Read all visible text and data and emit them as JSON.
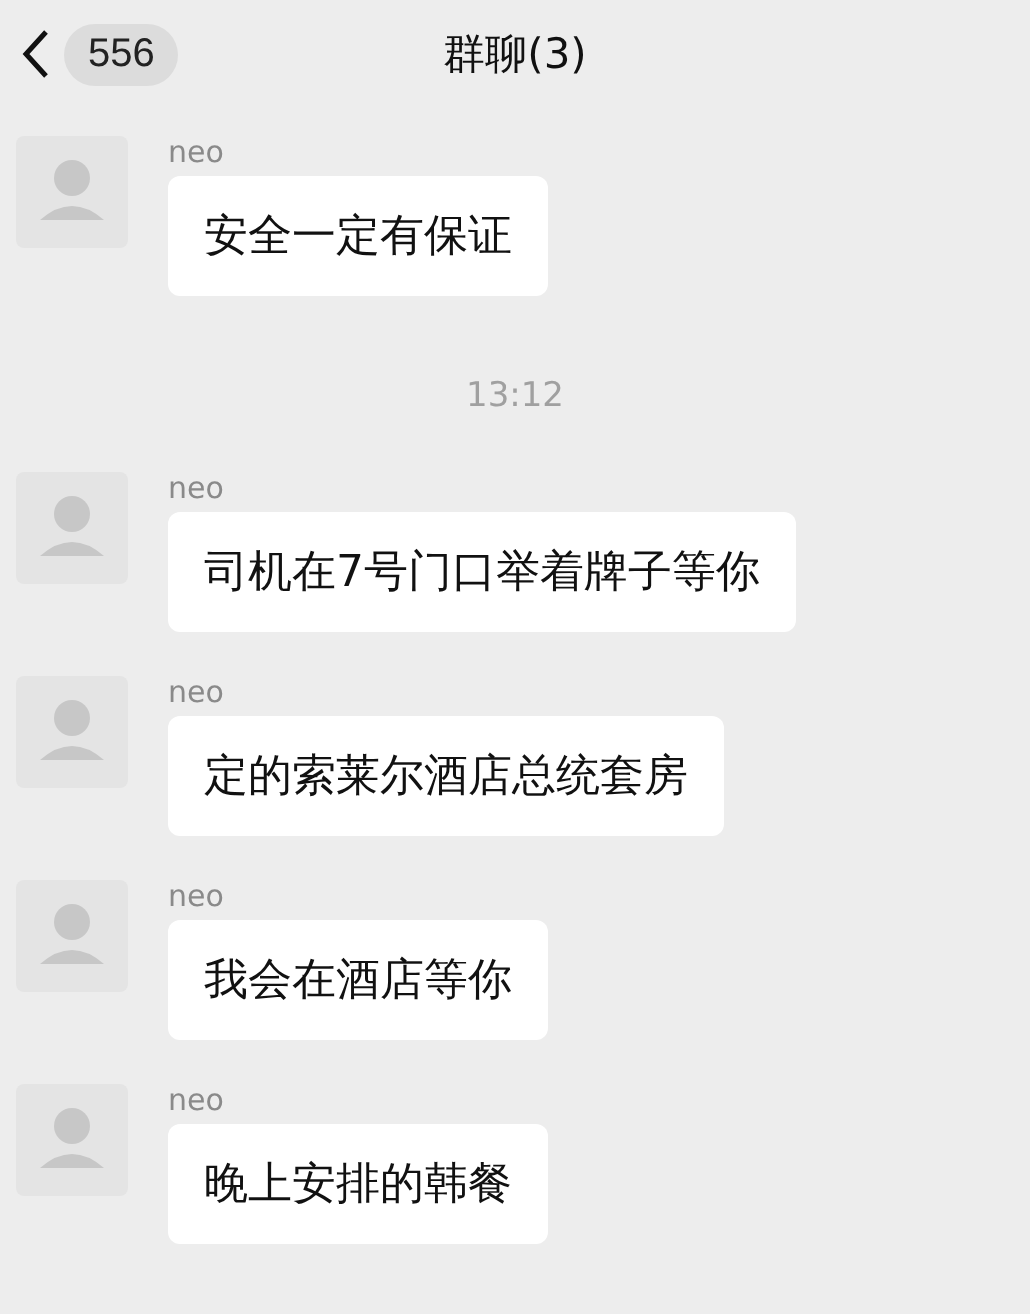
{
  "header": {
    "back_count": "556",
    "title": "群聊(3)"
  },
  "messages": [
    {
      "kind": "message",
      "sender": "neo",
      "text": "安全一定有保证"
    },
    {
      "kind": "time",
      "text": "13:12"
    },
    {
      "kind": "message",
      "sender": "neo",
      "text": "司机在7号门口举着牌子等你"
    },
    {
      "kind": "message",
      "sender": "neo",
      "text": "定的索莱尔酒店总统套房"
    },
    {
      "kind": "message",
      "sender": "neo",
      "text": "我会在酒店等你"
    },
    {
      "kind": "message",
      "sender": "neo",
      "text": "晚上安排的韩餐"
    }
  ]
}
